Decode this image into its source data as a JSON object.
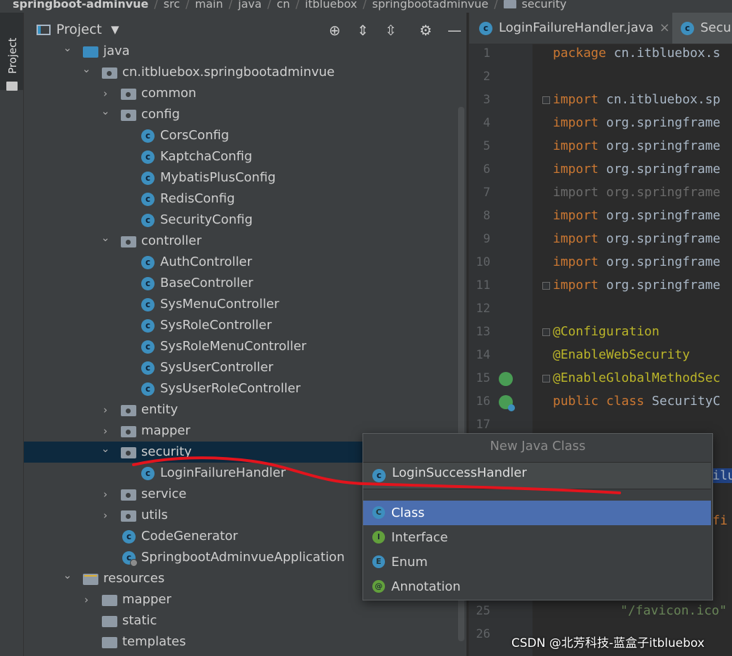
{
  "breadcrumb": [
    "springboot-adminvue",
    "src",
    "main",
    "java",
    "cn",
    "itbluebox",
    "springbootadminvue",
    "security"
  ],
  "side_stripe": {
    "label": "Project"
  },
  "project_panel": {
    "title": "Project",
    "toolbar_icons": [
      "locate-icon",
      "expand-all-icon",
      "collapse-all-icon",
      "gear-icon",
      "minimize-icon"
    ]
  },
  "tree": [
    {
      "label": "java",
      "kind": "src-folder",
      "indent": 4,
      "expanded": true
    },
    {
      "label": "cn.itbluebox.springbootadminvue",
      "kind": "package",
      "indent": 5,
      "expanded": true
    },
    {
      "label": "common",
      "kind": "package",
      "indent": 6,
      "expanded": false
    },
    {
      "label": "config",
      "kind": "package",
      "indent": 6,
      "expanded": true
    },
    {
      "label": "CorsConfig",
      "kind": "class",
      "indent": 7
    },
    {
      "label": "KaptchaConfig",
      "kind": "class",
      "indent": 7
    },
    {
      "label": "MybatisPlusConfig",
      "kind": "class",
      "indent": 7
    },
    {
      "label": "RedisConfig",
      "kind": "class",
      "indent": 7
    },
    {
      "label": "SecurityConfig",
      "kind": "class",
      "indent": 7
    },
    {
      "label": "controller",
      "kind": "package",
      "indent": 6,
      "expanded": true
    },
    {
      "label": "AuthController",
      "kind": "class",
      "indent": 7
    },
    {
      "label": "BaseController",
      "kind": "class",
      "indent": 7
    },
    {
      "label": "SysMenuController",
      "kind": "class",
      "indent": 7
    },
    {
      "label": "SysRoleController",
      "kind": "class",
      "indent": 7
    },
    {
      "label": "SysRoleMenuController",
      "kind": "class",
      "indent": 7
    },
    {
      "label": "SysUserController",
      "kind": "class",
      "indent": 7
    },
    {
      "label": "SysUserRoleController",
      "kind": "class",
      "indent": 7
    },
    {
      "label": "entity",
      "kind": "package",
      "indent": 6,
      "expanded": false
    },
    {
      "label": "mapper",
      "kind": "package",
      "indent": 6,
      "expanded": false
    },
    {
      "label": "security",
      "kind": "package",
      "indent": 6,
      "expanded": true,
      "selected": true
    },
    {
      "label": "LoginFailureHandler",
      "kind": "class",
      "indent": 7
    },
    {
      "label": "service",
      "kind": "package",
      "indent": 6,
      "expanded": false
    },
    {
      "label": "utils",
      "kind": "package",
      "indent": 6,
      "expanded": false
    },
    {
      "label": "CodeGenerator",
      "kind": "class",
      "indent": 6
    },
    {
      "label": "SpringbootAdminvueApplication",
      "kind": "class-run",
      "indent": 6
    },
    {
      "label": "resources",
      "kind": "res-folder",
      "indent": 4,
      "expanded": true
    },
    {
      "label": "mapper",
      "kind": "folder",
      "indent": 5,
      "expanded": false
    },
    {
      "label": "static",
      "kind": "folder",
      "indent": 5
    },
    {
      "label": "templates",
      "kind": "folder",
      "indent": 5
    }
  ],
  "editor": {
    "tabs": [
      {
        "label": "LoginFailureHandler.java",
        "close": "×"
      },
      {
        "label": "Secur"
      }
    ],
    "lines": [
      {
        "n": "1",
        "parts": [
          [
            "kw",
            "package "
          ],
          [
            "tx",
            "cn.itbluebox.s"
          ]
        ]
      },
      {
        "n": "2",
        "parts": []
      },
      {
        "n": "3",
        "parts": [
          [
            "kw",
            "import "
          ],
          [
            "tx",
            "cn.itbluebox.sp"
          ]
        ],
        "fold": true
      },
      {
        "n": "4",
        "parts": [
          [
            "kw",
            "import "
          ],
          [
            "tx",
            "org.springframe"
          ]
        ]
      },
      {
        "n": "5",
        "parts": [
          [
            "kw",
            "import "
          ],
          [
            "tx",
            "org.springframe"
          ]
        ]
      },
      {
        "n": "6",
        "parts": [
          [
            "kw",
            "import "
          ],
          [
            "tx",
            "org.springframe"
          ]
        ]
      },
      {
        "n": "7",
        "parts": [
          [
            "dim",
            "import org.springframe"
          ]
        ]
      },
      {
        "n": "8",
        "parts": [
          [
            "kw",
            "import "
          ],
          [
            "tx",
            "org.springframe"
          ]
        ]
      },
      {
        "n": "9",
        "parts": [
          [
            "kw",
            "import "
          ],
          [
            "tx",
            "org.springframe"
          ]
        ]
      },
      {
        "n": "10",
        "parts": [
          [
            "kw",
            "import "
          ],
          [
            "tx",
            "org.springframe"
          ]
        ]
      },
      {
        "n": "11",
        "parts": [
          [
            "kw",
            "import "
          ],
          [
            "tx",
            "org.springframe"
          ]
        ],
        "fold": true
      },
      {
        "n": "12",
        "parts": []
      },
      {
        "n": "13",
        "parts": [
          [
            "an",
            "@Configuration"
          ]
        ],
        "fold": true
      },
      {
        "n": "14",
        "parts": [
          [
            "an",
            "@EnableWebSecurity"
          ]
        ]
      },
      {
        "n": "15",
        "parts": [
          [
            "an",
            "@EnableGlobalMethodSec"
          ]
        ],
        "fold": true,
        "gicon": "check"
      },
      {
        "n": "16",
        "parts": [
          [
            "kw",
            "public class "
          ],
          [
            "tx",
            "SecurityC"
          ]
        ],
        "gicon": "bean"
      },
      {
        "n": "17",
        "parts": []
      }
    ],
    "partial_lines": [
      {
        "n": "25",
        "parts": [
          [
            "str",
            "\"/favicon.ico\""
          ]
        ]
      },
      {
        "n": "26",
        "parts": []
      }
    ],
    "peek_right": [
      "ilu",
      "fi"
    ]
  },
  "new_class_popup": {
    "title": "New Java Class",
    "input_value": "LoginSuccessHandler",
    "options": [
      {
        "label": "Class",
        "badge": "C",
        "color": "#3d8fbe",
        "selected": true
      },
      {
        "label": "Interface",
        "badge": "I",
        "color": "#62a03c",
        "selected": false
      },
      {
        "label": "Enum",
        "badge": "E",
        "color": "#3d8fbe",
        "selected": false
      },
      {
        "label": "Annotation",
        "badge": "@",
        "color": "#62a03c",
        "selected": false
      }
    ]
  },
  "watermark": "CSDN @北芳科技-蓝盒子itbluebox",
  "colors": {
    "accent": "#4b6eaf",
    "selection": "#0d293e",
    "annotation_stroke": "#e3141d"
  }
}
